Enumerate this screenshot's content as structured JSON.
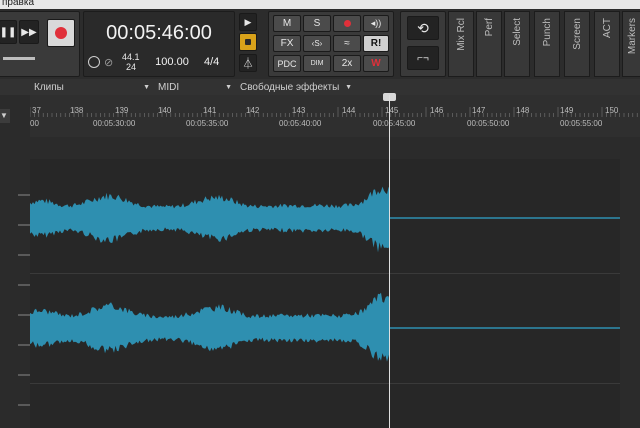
{
  "menu": {
    "partial_label": "правка"
  },
  "transport": {
    "time_display": "00:05:46:00",
    "sample_rate": "44.1",
    "bit_depth": "24",
    "tempo": "100.00",
    "meter": "4/4"
  },
  "mix_buttons": {
    "m": "M",
    "s": "S",
    "fx": "FX",
    "pdc": "PDC",
    "dim": "DIM",
    "two_x": "2x",
    "r_mark": "R!"
  },
  "modules": {
    "mix_rcl": "Mix Rcl",
    "perf": "Perf",
    "select": "Select",
    "punch": "Punch",
    "screen": "Screen",
    "act": "ACT",
    "markers": "Markers"
  },
  "header": {
    "clips": "Клипы",
    "midi": "MIDI",
    "free_effects": "Свободные эффекты"
  },
  "ruler": {
    "bars": [
      "37",
      "138",
      "139",
      "140",
      "141",
      "142",
      "143",
      "144",
      "145",
      "146",
      "147",
      "148",
      "149",
      "150"
    ],
    "times": [
      "00",
      "00:05:30:00",
      "00:05:35:00",
      "00:05:40:00",
      "00:05:45:00",
      "00:05:50:00",
      "00:05:55:00"
    ]
  },
  "colors": {
    "waveform": "#2e8fb0",
    "record_red": "#e0303a",
    "accent_orange": "#d8a21a",
    "playhead": "#e0e0e0"
  }
}
